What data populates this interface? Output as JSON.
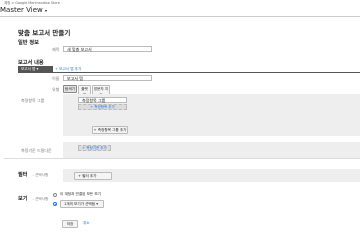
{
  "breadcrumb": "계정 > Google Merchandise Store",
  "view_title": "Master View",
  "page_title": "맞춤 보고서 만들기",
  "general": {
    "section_label": "일반 정보",
    "title_label": "제목",
    "title_value": "새 맞춤 보고서"
  },
  "report_content": {
    "section_label": "보고서 내용",
    "tab_label": "보고서 탭",
    "add_tab_label": "+ 보고서 탭 추가",
    "name_label": "이름",
    "name_value": "보고서 탭",
    "type_label": "유형",
    "type_buttons": [
      "탐색기",
      "플랫 표",
      "방문자 지도"
    ],
    "metric_group_label": "측정항목 그룹",
    "metric_group_name": "측정항목 그룹",
    "add_metric_label": "+ 측정항목 추가",
    "add_metric_group_label": "+ 측정항목 그룹 추가",
    "drilldown_label": "측정기준 드릴다운",
    "add_dimension_label": "+ 측정기준 추가"
  },
  "filters": {
    "section_label": "필터",
    "optional": "- 선택사항",
    "add_filter_label": "+ 필터 추가"
  },
  "views": {
    "section_label": "보기",
    "optional": "- 선택사항",
    "option_all": "이 계정과 연결된 모든 보기",
    "option_one": "1개의 보기가 선택됨"
  },
  "actions": {
    "save": "저장",
    "cancel": "취소"
  },
  "colors": {
    "accent": "#1a73e8",
    "tab_active": "#555555",
    "panel": "#eeeeee"
  }
}
